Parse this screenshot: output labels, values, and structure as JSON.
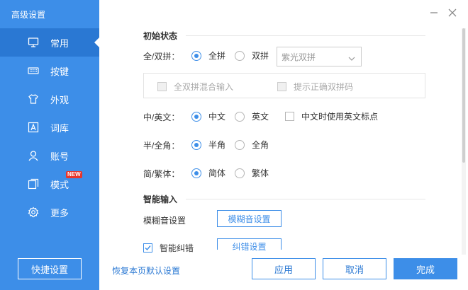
{
  "window": {
    "title": "高级设置"
  },
  "sidebar": {
    "items": [
      {
        "label": "常用",
        "icon": "monitor-icon",
        "active": true
      },
      {
        "label": "按键",
        "icon": "keyboard-icon"
      },
      {
        "label": "外观",
        "icon": "shirt-icon"
      },
      {
        "label": "词库",
        "icon": "dictionary-icon"
      },
      {
        "label": "账号",
        "icon": "user-icon"
      },
      {
        "label": "模式",
        "icon": "mode-icon",
        "badge": "NEW"
      },
      {
        "label": "更多",
        "icon": "gear-icon"
      }
    ],
    "quick_settings": "快捷设置"
  },
  "content": {
    "initial_state": {
      "title": "初始状态",
      "pinyin": {
        "label": "全/双拼：",
        "options": [
          "全拼",
          "双拼"
        ],
        "selected": 0,
        "scheme_value": "紫光双拼"
      },
      "sub_options": [
        "全双拼混合输入",
        "提示正确双拼码"
      ],
      "lang": {
        "label": "中/英文：",
        "options": [
          "中文",
          "英文"
        ],
        "selected": 0,
        "extra": "中文时使用英文标点"
      },
      "width": {
        "label": "半/全角：",
        "options": [
          "半角",
          "全角"
        ],
        "selected": 0
      },
      "script": {
        "label": "简/繁体：",
        "options": [
          "简体",
          "繁体"
        ],
        "selected": 0
      }
    },
    "smart_input": {
      "title": "智能输入",
      "fuzzy_label": "模糊音设置",
      "fuzzy_button": "模糊音设置",
      "correction_label": "智能纠错",
      "correction_button": "纠错设置"
    }
  },
  "footer": {
    "restore": "恢复本页默认设置",
    "apply": "应用",
    "cancel": "取消",
    "done": "完成"
  },
  "colors": {
    "accent": "#3d8ee8",
    "accent_dark": "#2a78d3",
    "badge": "#e8362c"
  }
}
